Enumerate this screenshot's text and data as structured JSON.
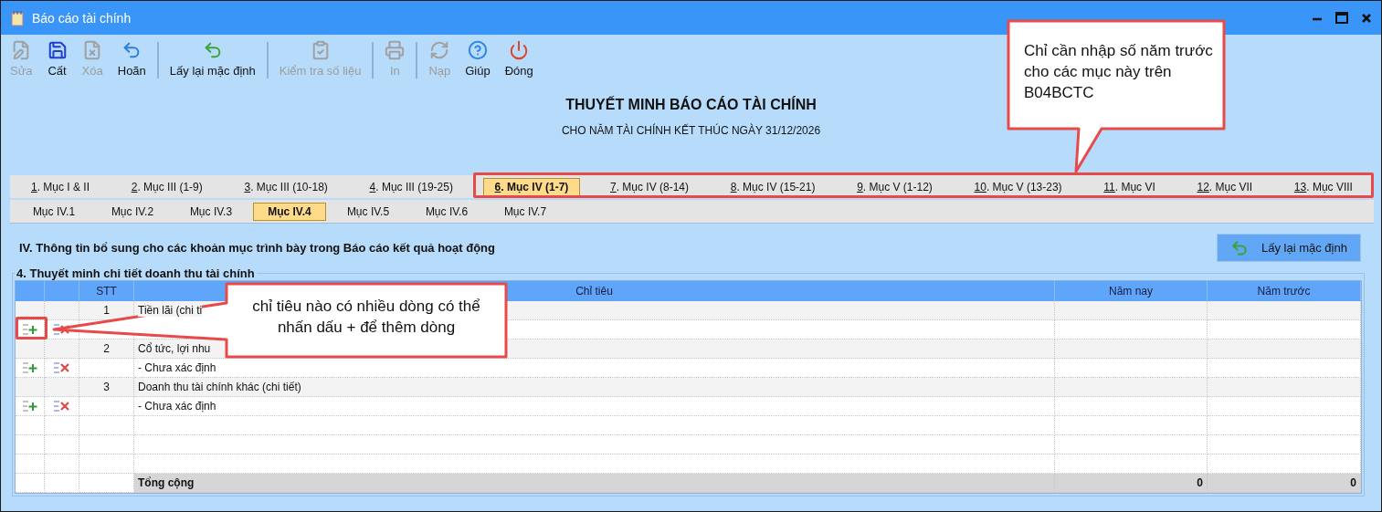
{
  "window": {
    "title": "Báo cáo tài chính"
  },
  "toolbar": [
    {
      "kind": "button",
      "label": "Sửa",
      "disabled": true
    },
    {
      "kind": "button",
      "label": "Cất",
      "disabled": false
    },
    {
      "kind": "button",
      "label": "Xóa",
      "disabled": true
    },
    {
      "kind": "button",
      "label": "Hoãn",
      "disabled": false
    },
    {
      "kind": "separator"
    },
    {
      "kind": "button",
      "label": "Lấy lại mặc định",
      "disabled": false
    },
    {
      "kind": "separator"
    },
    {
      "kind": "button",
      "label": "Kiểm tra số liệu",
      "disabled": true
    },
    {
      "kind": "separator"
    },
    {
      "kind": "button",
      "label": "In",
      "disabled": true
    },
    {
      "kind": "separator"
    },
    {
      "kind": "button",
      "label": "Nạp",
      "disabled": true
    },
    {
      "kind": "button",
      "label": "Giúp",
      "disabled": false
    },
    {
      "kind": "button",
      "label": "Đóng",
      "disabled": false
    }
  ],
  "report": {
    "title": "THUYẾT MINH BÁO CÁO TÀI CHÍNH",
    "subtitle": "CHO NĂM TÀI CHÍNH KẾT THÚC NGÀY 31/12/2026"
  },
  "section_tabs": [
    {
      "label": "1. Mục I & II",
      "selected": false
    },
    {
      "label": "2. Mục III (1-9)",
      "selected": false
    },
    {
      "label": "3. Mục III (10-18)",
      "selected": false
    },
    {
      "label": "4. Mục III (19-25)",
      "selected": false
    },
    {
      "label": "6. Mục IV (1-7)",
      "selected": true
    },
    {
      "label": "7. Mục IV (8-14)",
      "selected": false
    },
    {
      "label": "8. Mục IV (15-21)",
      "selected": false
    },
    {
      "label": "9. Mục V (1-12)",
      "selected": false
    },
    {
      "label": "10. Mục V (13-23)",
      "selected": false
    },
    {
      "label": "11. Mục VI",
      "selected": false
    },
    {
      "label": "12. Mục VII",
      "selected": false
    },
    {
      "label": "13. Mục VIII",
      "selected": false
    }
  ],
  "sub_tabs": [
    {
      "label": "Mục IV.1",
      "selected": false
    },
    {
      "label": "Mục IV.2",
      "selected": false
    },
    {
      "label": "Mục IV.3",
      "selected": false
    },
    {
      "label": "Mục IV.4",
      "selected": true
    },
    {
      "label": "Mục IV.5",
      "selected": false
    },
    {
      "label": "Mục IV.6",
      "selected": false
    },
    {
      "label": "Mục IV.7",
      "selected": false
    }
  ],
  "section": {
    "heading": "IV. Thông tin bổ sung cho các khoản mục trình bày trong Báo cáo kết quả hoạt động",
    "reset_button": "Lấy lại mặc định",
    "group_title": "4. Thuyết minh chi tiết doanh thu tài chính"
  },
  "table": {
    "columns": [
      "STT",
      "Chỉ tiêu",
      "Năm nay",
      "Năm trước"
    ],
    "rows": [
      {
        "kind": "item",
        "stt": "1",
        "name": "Tiền lãi (chi ti"
      },
      {
        "kind": "detail"
      },
      {
        "kind": "item",
        "stt": "2",
        "name": "Cổ tức, lợi nhu"
      },
      {
        "kind": "detail",
        "name": "- Chưa xác định"
      },
      {
        "kind": "item",
        "stt": "3",
        "name": "Doanh thu tài chính khác (chi tiết)"
      },
      {
        "kind": "detail",
        "name": "- Chưa xác định"
      },
      {
        "kind": "blank"
      },
      {
        "kind": "blank"
      },
      {
        "kind": "blank"
      }
    ],
    "total": {
      "label": "Tổng cộng",
      "current_year": "0",
      "previous_year": "0"
    }
  },
  "callouts": [
    {
      "text": "Chỉ cần nhập số năm trước cho các mục này trên B04BCTC"
    },
    {
      "text": "chỉ tiêu nào có nhiều dòng có thể nhấn dấu + để thêm dòng"
    }
  ]
}
